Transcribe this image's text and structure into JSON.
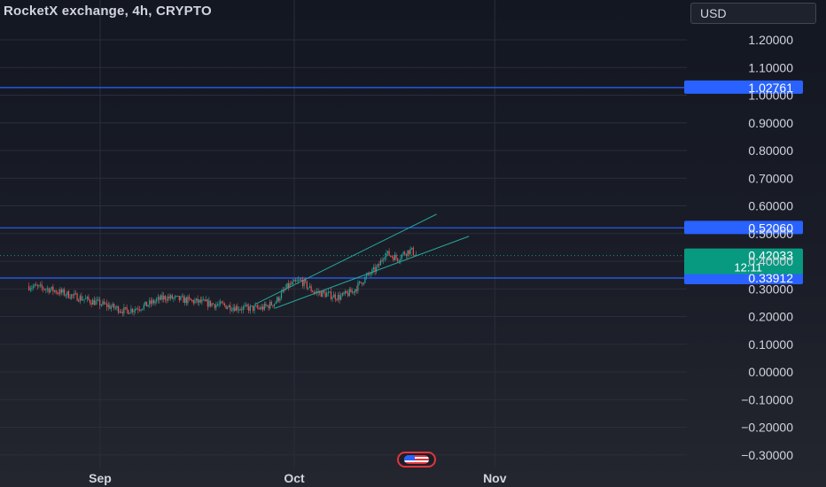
{
  "header": {
    "title": "RocketX exchange, 4h, CRYPTO",
    "currency": "USD"
  },
  "colors": {
    "background": "#131722",
    "grid": "#2a2e39",
    "bull": "#26a69a",
    "bear": "#ef5350",
    "level_line": "#2962ff",
    "channel": "#26a69a",
    "axis_text": "#d1d4dc",
    "price_badge": "#089981"
  },
  "chart_data": {
    "type": "candlestick",
    "interval": "4h",
    "x_labels": [
      "Sep",
      "Oct",
      "Nov"
    ],
    "y_ticks": [
      "1.20000",
      "1.10000",
      "1.00000",
      "0.90000",
      "0.80000",
      "0.70000",
      "0.60000",
      "0.50000",
      "0.40000",
      "0.30000",
      "0.20000",
      "0.10000",
      "0.00000",
      "−0.10000",
      "−0.20000",
      "−0.30000"
    ],
    "ylim": [
      -0.33,
      1.3
    ],
    "grid": true,
    "horizontal_levels": [
      {
        "label": "1.02761",
        "value": 1.02761
      },
      {
        "label": "0.52060",
        "value": 0.5206
      },
      {
        "label": "0.33912",
        "value": 0.33912
      }
    ],
    "current_price": {
      "label": "0.42033",
      "value": 0.42033,
      "countdown": "12:11"
    },
    "channel": {
      "upper": [
        {
          "date": "Sep 25",
          "value": 0.245
        },
        {
          "date": "Oct 23",
          "value": 0.57
        }
      ],
      "lower": [
        {
          "date": "Sep 28",
          "value": 0.23
        },
        {
          "date": "Oct 28",
          "value": 0.49
        }
      ]
    },
    "price_path": [
      [
        "Aug 21",
        0.31
      ],
      [
        "Aug 24",
        0.3
      ],
      [
        "Aug 27",
        0.28
      ],
      [
        "Aug 30",
        0.26
      ],
      [
        "Sep 2",
        0.24
      ],
      [
        "Sep 5",
        0.22
      ],
      [
        "Sep 8",
        0.24
      ],
      [
        "Sep 11",
        0.27
      ],
      [
        "Sep 14",
        0.26
      ],
      [
        "Sep 17",
        0.25
      ],
      [
        "Sep 20",
        0.24
      ],
      [
        "Sep 23",
        0.23
      ],
      [
        "Sep 26",
        0.23
      ],
      [
        "Sep 28",
        0.25
      ],
      [
        "Sep 30",
        0.31
      ],
      [
        "Oct 2",
        0.33
      ],
      [
        "Oct 4",
        0.29
      ],
      [
        "Oct 6",
        0.28
      ],
      [
        "Oct 8",
        0.27
      ],
      [
        "Oct 10",
        0.29
      ],
      [
        "Oct 12",
        0.34
      ],
      [
        "Oct 14",
        0.38
      ],
      [
        "Oct 15",
        0.43
      ],
      [
        "Oct 17",
        0.41
      ],
      [
        "Oct 18",
        0.43
      ],
      [
        "Oct 19",
        0.44
      ],
      [
        "Oct 20",
        0.42
      ]
    ]
  }
}
